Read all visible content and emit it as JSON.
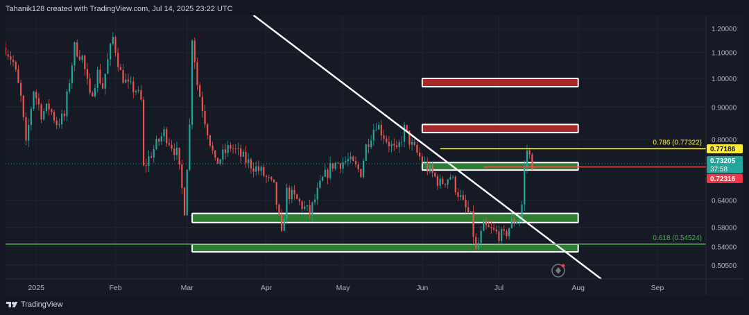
{
  "header": {
    "text": "Tahanik128 created with TradingView.com, Jul 14, 2025 23:22 UTC"
  },
  "footer": {
    "brand": "TradingView"
  },
  "colors": {
    "background": "#131722",
    "up": "#26a69a",
    "down": "#ef5350",
    "zone_red": "#a52a2a",
    "zone_green": "#2e7d32",
    "trendline": "#ffffff",
    "fib_786": "#ffeb3b",
    "fib_618": "#4caf50",
    "price_label": "#26a69a",
    "prev_close_label": "#f23645"
  },
  "chart_data": {
    "type": "candlestick",
    "scale": "log",
    "x_axis": {
      "labels": [
        {
          "label": "2025",
          "date": "2025-01-01"
        },
        {
          "label": "Feb",
          "date": "2025-02-01"
        },
        {
          "label": "Mar",
          "date": "2025-03-01"
        },
        {
          "label": "Apr",
          "date": "2025-04-01"
        },
        {
          "label": "May",
          "date": "2025-05-01"
        },
        {
          "label": "Jun",
          "date": "2025-06-01"
        },
        {
          "label": "Jul",
          "date": "2025-07-01"
        },
        {
          "label": "Aug",
          "date": "2025-08-01"
        },
        {
          "label": "Sep",
          "date": "2025-09-01"
        }
      ],
      "range": [
        "2024-12-20",
        "2025-09-20"
      ]
    },
    "y_axis": {
      "ticks": [
        "1.20000",
        "1.10000",
        "1.00000",
        "0.90000",
        "0.80000",
        "0.64000",
        "0.58000",
        "0.54000",
        "0.50500"
      ],
      "range": [
        0.48,
        1.26
      ]
    },
    "price_path": [
      [
        "2024-12-20",
        1.12
      ],
      [
        "2024-12-23",
        1.06
      ],
      [
        "2024-12-26",
        0.93
      ],
      [
        "2024-12-28",
        0.78
      ],
      [
        "2024-12-31",
        0.96
      ],
      [
        "2025-01-03",
        0.88
      ],
      [
        "2025-01-06",
        0.9
      ],
      [
        "2025-01-09",
        0.85
      ],
      [
        "2025-01-12",
        0.87
      ],
      [
        "2025-01-16",
        1.12
      ],
      [
        "2025-01-19",
        1.08
      ],
      [
        "2025-01-22",
        0.93
      ],
      [
        "2025-01-25",
        1.02
      ],
      [
        "2025-01-27",
        0.97
      ],
      [
        "2025-01-31",
        1.16
      ],
      [
        "2025-02-03",
        1.02
      ],
      [
        "2025-02-06",
        0.97
      ],
      [
        "2025-02-09",
        0.96
      ],
      [
        "2025-02-11",
        0.92
      ],
      [
        "2025-02-12",
        0.72
      ],
      [
        "2025-02-15",
        0.76
      ],
      [
        "2025-02-20",
        0.82
      ],
      [
        "2025-02-25",
        0.76
      ],
      [
        "2025-02-28",
        0.62
      ],
      [
        "2025-03-02",
        0.84
      ],
      [
        "2025-03-03",
        1.17
      ],
      [
        "2025-03-05",
        0.98
      ],
      [
        "2025-03-08",
        0.86
      ],
      [
        "2025-03-12",
        0.73
      ],
      [
        "2025-03-18",
        0.78
      ],
      [
        "2025-03-24",
        0.74
      ],
      [
        "2025-03-30",
        0.71
      ],
      [
        "2025-04-04",
        0.67
      ],
      [
        "2025-04-07",
        0.56
      ],
      [
        "2025-04-09",
        0.66
      ],
      [
        "2025-04-13",
        0.64
      ],
      [
        "2025-04-18",
        0.61
      ],
      [
        "2025-04-23",
        0.69
      ],
      [
        "2025-04-27",
        0.73
      ],
      [
        "2025-05-03",
        0.74
      ],
      [
        "2025-05-08",
        0.71
      ],
      [
        "2025-05-10",
        0.78
      ],
      [
        "2025-05-14",
        0.85
      ],
      [
        "2025-05-18",
        0.8
      ],
      [
        "2025-05-22",
        0.76
      ],
      [
        "2025-05-25",
        0.83
      ],
      [
        "2025-05-28",
        0.78
      ],
      [
        "2025-06-03",
        0.72
      ],
      [
        "2025-06-08",
        0.68
      ],
      [
        "2025-06-12",
        0.7
      ],
      [
        "2025-06-17",
        0.63
      ],
      [
        "2025-06-20",
        0.6
      ],
      [
        "2025-06-22",
        0.53
      ],
      [
        "2025-06-25",
        0.58
      ],
      [
        "2025-06-29",
        0.57
      ],
      [
        "2025-07-03",
        0.56
      ],
      [
        "2025-07-06",
        0.59
      ],
      [
        "2025-07-09",
        0.6
      ],
      [
        "2025-07-10",
        0.63
      ],
      [
        "2025-07-11",
        0.72
      ],
      [
        "2025-07-12",
        0.77
      ],
      [
        "2025-07-14",
        0.73205
      ]
    ],
    "zones": [
      {
        "color": "red",
        "from": "2025-06-01",
        "to": "2025-08-01",
        "low": 0.97,
        "high": 1.0
      },
      {
        "color": "red",
        "from": "2025-06-01",
        "to": "2025-08-01",
        "low": 0.82,
        "high": 0.845
      },
      {
        "color": "green",
        "from": "2025-06-01",
        "to": "2025-08-01",
        "low": 0.715,
        "high": 0.735
      },
      {
        "color": "green",
        "from": "2025-03-03",
        "to": "2025-08-01",
        "low": 0.59,
        "high": 0.61
      },
      {
        "color": "green",
        "from": "2025-03-03",
        "to": "2025-08-01",
        "low": 0.53,
        "high": 0.545
      }
    ],
    "trendline": {
      "from": [
        "2025-03-27",
        1.26
      ],
      "to": [
        "2025-08-10",
        0.48
      ]
    },
    "fib_levels": [
      {
        "label": "0.786 (0.77322)",
        "value": 0.77322,
        "color": "yellow",
        "from": "2025-06-08"
      },
      {
        "label": "0.618 (0.54524)",
        "value": 0.54524,
        "color": "green",
        "from": "2024-12-20"
      }
    ],
    "horizontal_lines": [
      {
        "value": 0.72316,
        "color": "red",
        "from": "2025-06-25"
      }
    ],
    "price_labels": [
      {
        "text": "0.77186",
        "value": 0.77186,
        "kind": "yellow"
      },
      {
        "text": "0.73205",
        "value": 0.73205,
        "kind": "last"
      },
      {
        "text": "37:58",
        "value": 0.73205,
        "kind": "countdown"
      },
      {
        "text": "0.72316",
        "value": 0.72316,
        "kind": "red"
      }
    ]
  }
}
